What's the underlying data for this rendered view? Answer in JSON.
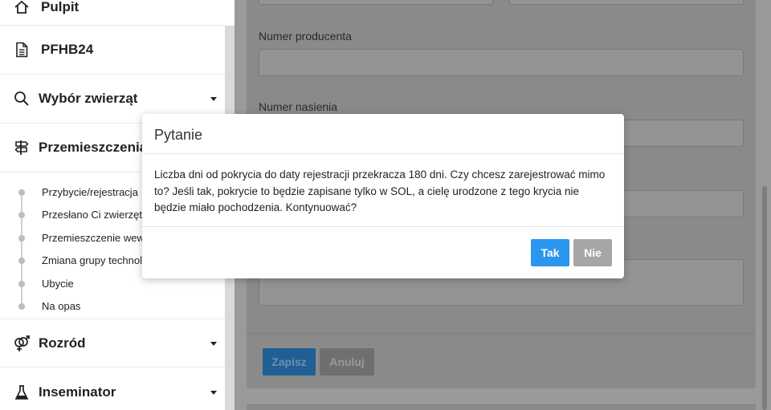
{
  "sidebar": {
    "items": [
      {
        "label": "Pulpit",
        "icon": "home-icon"
      },
      {
        "label": "PFHB24",
        "icon": "document-icon"
      },
      {
        "label": "Wybór zwierząt",
        "icon": "search-icon"
      },
      {
        "label": "Przemieszczenia",
        "icon": "signpost-icon"
      },
      {
        "label": "Rozród",
        "icon": "gender-icon"
      },
      {
        "label": "Inseminator",
        "icon": "flask-icon"
      }
    ],
    "submenu": [
      "Przybycie/rejestracja",
      "Przesłano Ci zwierzęta",
      "Przemieszczenie wew",
      "Zmiana grupy technol",
      "Ubycie",
      "Na opas"
    ]
  },
  "form": {
    "producer_number_label": "Numer producenta",
    "semen_number_label": "Numer nasienia",
    "save_label": "Zapisz",
    "cancel_label": "Anuluj"
  },
  "modal": {
    "title": "Pytanie",
    "message": "Liczba dni od pokrycia do daty rejestracji przekracza 180 dni. Czy chcesz zarejestrować mimo to? Jeśli tak, pokrycie to będzie zapisane tylko w SOL, a cielę urodzone z tego krycia nie będzie miało pochodzenia. Kontynuować?",
    "yes_label": "Tak",
    "no_label": "Nie"
  },
  "colors": {
    "primary": "#2a96ee",
    "secondary": "#a6a6a6"
  }
}
